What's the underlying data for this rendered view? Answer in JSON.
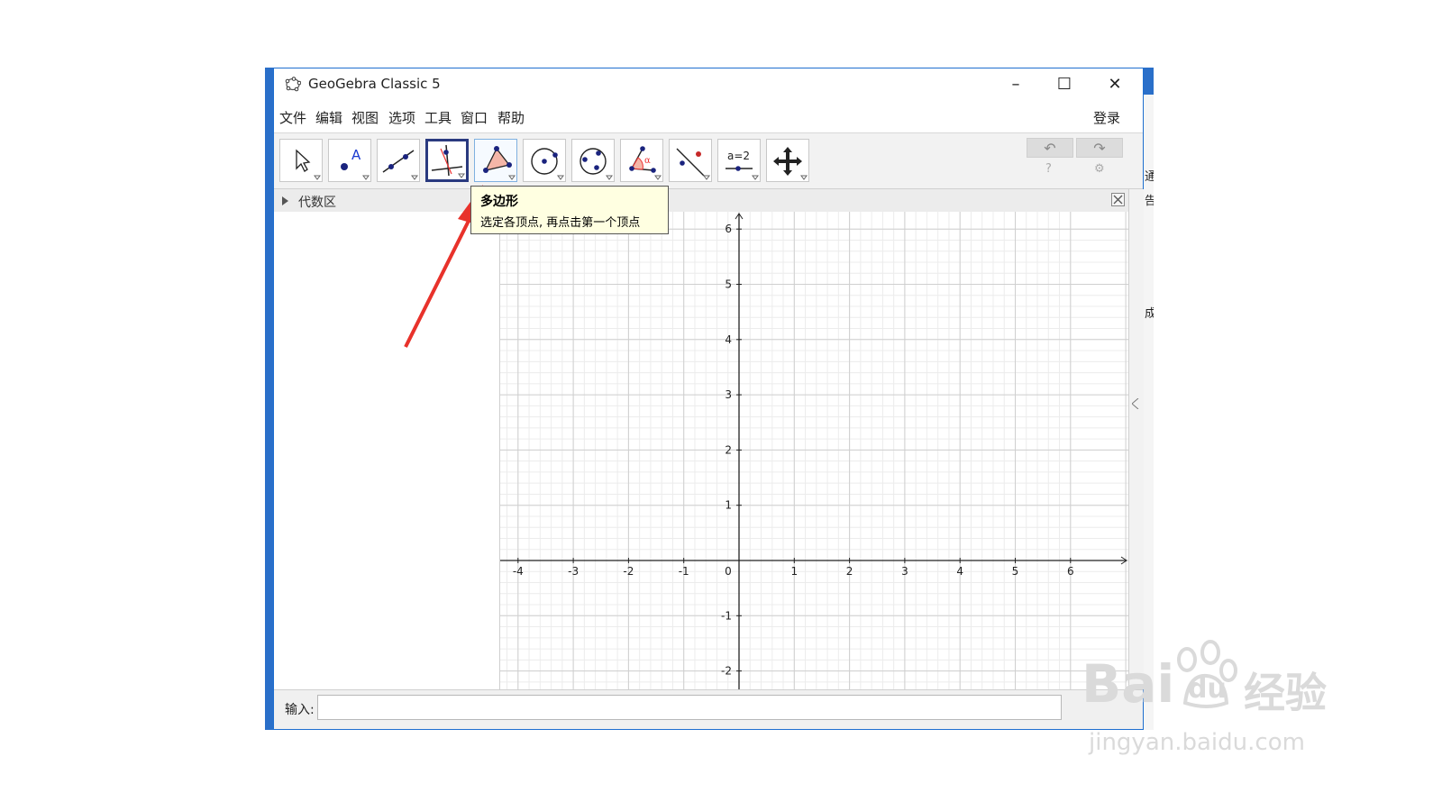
{
  "window": {
    "title": "GeoGebra Classic 5",
    "controls": {
      "minimize": "–",
      "maximize": "☐",
      "close": "✕"
    }
  },
  "menubar": {
    "items": [
      "文件",
      "编辑",
      "视图",
      "选项",
      "工具",
      "窗口",
      "帮助"
    ],
    "login": "登录"
  },
  "toolbar": {
    "tools": [
      {
        "name": "move-tool",
        "icon": "pointer-icon"
      },
      {
        "name": "point-tool",
        "icon": "point-icon"
      },
      {
        "name": "line-tool",
        "icon": "line-icon"
      },
      {
        "name": "perpendicular-line-tool",
        "icon": "perpendicular-icon",
        "selected": true
      },
      {
        "name": "polygon-tool",
        "icon": "polygon-icon",
        "hovered": true
      },
      {
        "name": "circle-tool",
        "icon": "circle-center-point-icon"
      },
      {
        "name": "ellipse-tool",
        "icon": "ellipse-icon"
      },
      {
        "name": "angle-tool",
        "icon": "angle-icon"
      },
      {
        "name": "reflect-tool",
        "icon": "reflect-icon"
      },
      {
        "name": "slider-tool",
        "icon": "slider-icon",
        "label": "a=2"
      },
      {
        "name": "move-graphics-view-tool",
        "icon": "move-view-icon"
      }
    ],
    "undo_icon": "↶",
    "redo_icon": "↷",
    "help_icon": "?",
    "settings_icon": "⚙"
  },
  "algebra": {
    "title": "代数区"
  },
  "tooltip": {
    "title": "多边形",
    "description": "选定各顶点, 再点击第一个顶点"
  },
  "graph": {
    "x_ticks": [
      "-4",
      "-3",
      "-2",
      "-1",
      "0",
      "1",
      "2",
      "3",
      "4",
      "5",
      "6"
    ],
    "y_ticks": [
      "6",
      "5",
      "4",
      "3",
      "2",
      "1",
      "-1",
      "-2"
    ]
  },
  "input": {
    "label": "输入:",
    "value": ""
  },
  "right_panel": {
    "glyphs": [
      "通",
      "告",
      "成"
    ]
  },
  "watermark": {
    "brand": "Bai",
    "brand2": "du",
    "cn": "经验",
    "url": "jingyan.baidu.com"
  },
  "colors": {
    "accent": "#2a6fc9",
    "selected_border": "#2a3a7f",
    "arrow": "#e8322b",
    "tooltip_bg": "#ffffe1"
  }
}
